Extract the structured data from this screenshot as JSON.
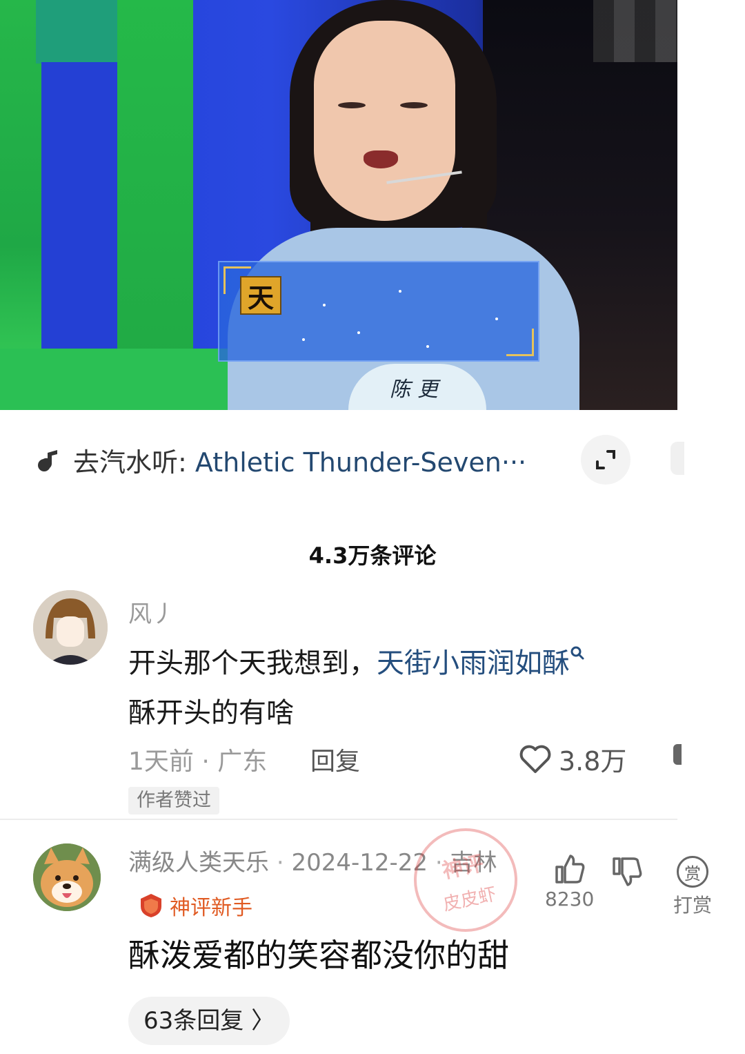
{
  "video": {
    "caption_char": "天",
    "nametag": "陈更"
  },
  "music": {
    "prefix": "去汽水听: ",
    "song": "Athletic Thunder-Seven···",
    "icon": "music-note-icon",
    "expand_icon": "expand-icon"
  },
  "comments_header": {
    "count_label": "4.3万条评论"
  },
  "comment1": {
    "username": "风丿",
    "text_before": "开头那个天我想到，",
    "search_link": "天街小雨润如酥",
    "text_after": "酥开头的有啥",
    "time": "1天前",
    "location": "广东",
    "reply_label": "回复",
    "like_count": "3.8万",
    "author_tag": "作者赞过"
  },
  "comment2": {
    "username": "满级人类天乐",
    "date": "2024-12-22",
    "location": "吉林",
    "badge": "神评新手",
    "text": "酥泼爱都的笑容都没你的甜",
    "replies_label": "63条回复 〉",
    "like_count": "8230",
    "reward_icon_char": "赏",
    "reward_label": "打赏"
  },
  "watermark": {
    "top": "神评",
    "bottom": "皮皮虾"
  },
  "colors": {
    "link": "#244e7e",
    "badge": "#e05a22",
    "meta": "#9a9a9a"
  }
}
